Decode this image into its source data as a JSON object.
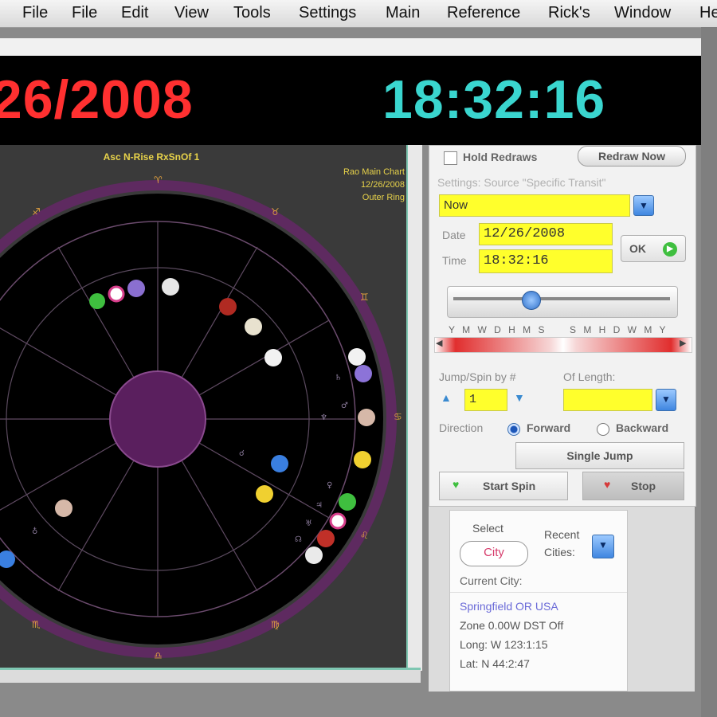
{
  "menu": {
    "items": [
      "File",
      "File",
      "Edit",
      "View",
      "Tools",
      "Settings",
      "Main",
      "Reference",
      "Rick's",
      "Window",
      "He"
    ]
  },
  "clock": {
    "date": "/26/2008",
    "time": "18:32:16",
    "date_color": "#ff3030",
    "time_color": "#3ad6cf"
  },
  "chart": {
    "header": "Asc N-Rise RxSnOf 1",
    "info_line1": "Rao Main Chart",
    "info_line2": "12/26/2008",
    "info_line3": "Outer Ring",
    "ring_color": "#6b2f6e",
    "center_color": "#5a1f5e"
  },
  "controls": {
    "hold_redraws": "Hold Redraws",
    "redraw_now": "Redraw Now",
    "settings_source": "Settings: Source \"Specific Transit\"",
    "source_value": "Now",
    "date_label": "Date",
    "date_value": "12/26/2008",
    "time_label": "Time",
    "time_value": "18:32:16",
    "ok_label": "OK",
    "scale_left": "Y M W D H M S",
    "scale_right": "S M H D W M Y",
    "jump_label": "Jump/Spin by #",
    "jump_value": "1",
    "length_label": "Of Length:",
    "direction_label": "Direction",
    "forward_label": "Forward",
    "backward_label": "Backward",
    "single_jump": "Single Jump",
    "start_spin": "Start Spin",
    "stop": "Stop"
  },
  "city": {
    "select_label": "Select",
    "city_button": "City",
    "recent_label": "Recent",
    "cities_label": "Cities:",
    "current_city_label": "Current City:",
    "name": "Springfield OR USA",
    "zone": "Zone 0.00W  DST Off",
    "long": "Long: W 123:1:15",
    "lat": "Lat: N 44:2:47"
  }
}
